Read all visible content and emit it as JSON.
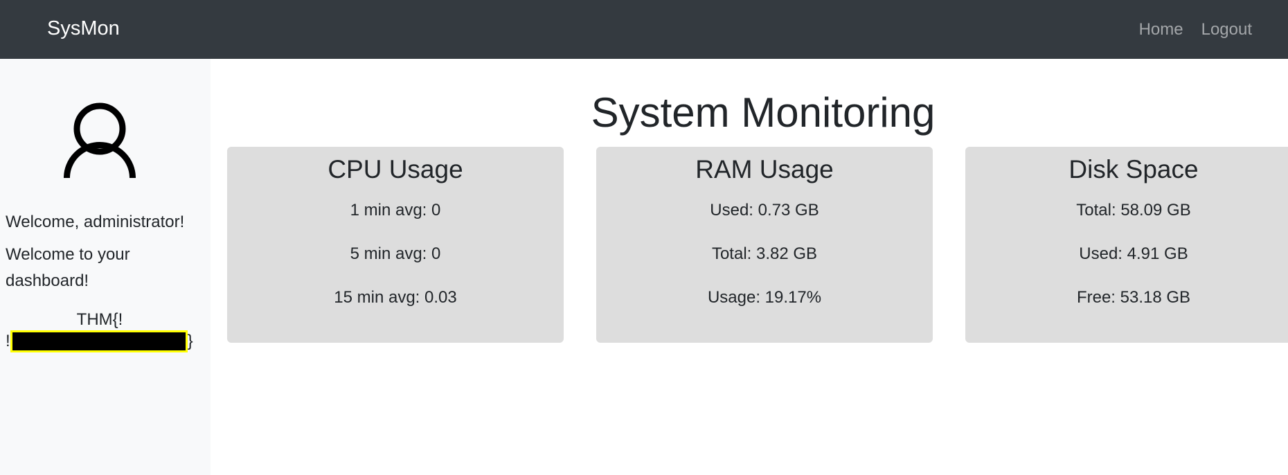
{
  "navbar": {
    "brand": "SysMon",
    "links": [
      "Home",
      "Logout"
    ]
  },
  "sidebar": {
    "avatar_icon": "user-icon",
    "welcome_user": "Welcome, administrator!",
    "welcome_dashboard": "Welcome to your dashboard!",
    "flag_prefix": "THM{!",
    "flag_lead": "!",
    "flag_suffix": "}"
  },
  "main": {
    "title": "System Monitoring",
    "cards": [
      {
        "title": "CPU Usage",
        "stats": [
          "1 min avg: 0",
          "5 min avg: 0",
          "15 min avg: 0.03"
        ]
      },
      {
        "title": "RAM Usage",
        "stats": [
          "Used: 0.73 GB",
          "Total: 3.82 GB",
          "Usage: 19.17%"
        ]
      },
      {
        "title": "Disk Space",
        "stats": [
          "Total: 58.09 GB",
          "Used: 4.91 GB",
          "Free: 53.18 GB"
        ]
      }
    ]
  },
  "colors": {
    "navbar_bg": "#343a40",
    "sidebar_bg": "#f8f9fa",
    "card_bg": "#dddddd",
    "redaction": "#000000",
    "redaction_border": "#ffff00"
  }
}
